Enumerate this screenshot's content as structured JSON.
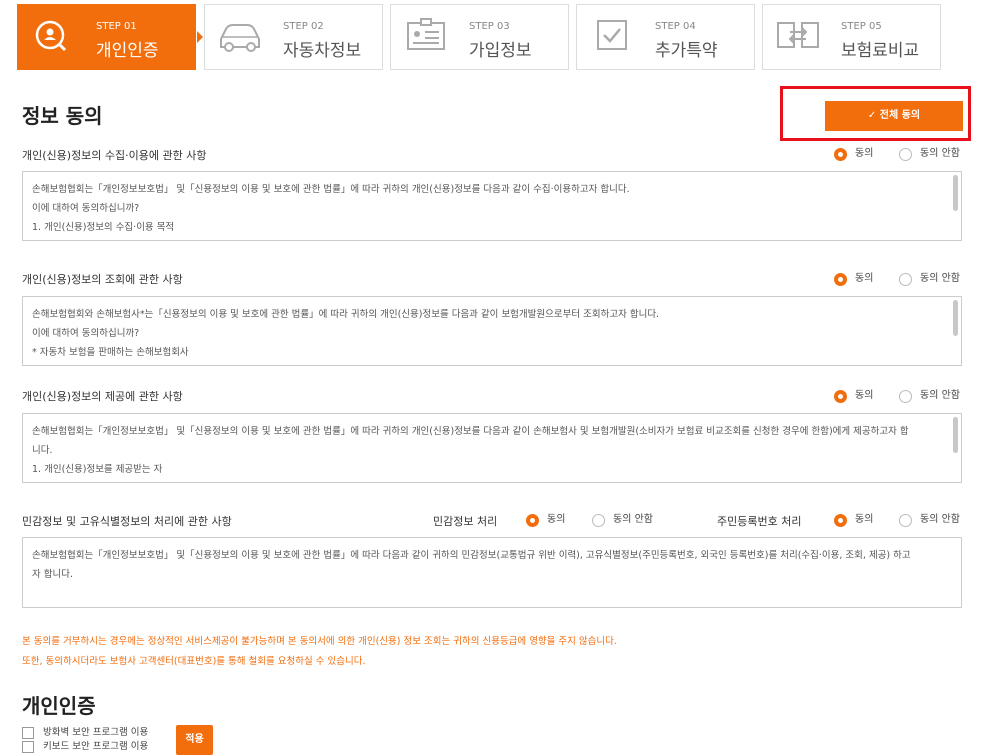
{
  "steps": [
    {
      "num": "STEP 01",
      "label": "개인인증",
      "icon": "search-person-icon"
    },
    {
      "num": "STEP 02",
      "label": "자동차정보",
      "icon": "car-icon"
    },
    {
      "num": "STEP 03",
      "label": "가입정보",
      "icon": "id-card-icon"
    },
    {
      "num": "STEP 04",
      "label": "추가특약",
      "icon": "checkbox-icon"
    },
    {
      "num": "STEP 05",
      "label": "보험료비교",
      "icon": "compare-arrows-icon"
    }
  ],
  "consent": {
    "title": "정보 동의",
    "all_agree_label": "✓ 전체 동의",
    "agree": "동의",
    "disagree": "동의 안함",
    "sections": [
      {
        "title": "개인(신용)정보의 수집·이용에 관한 사항",
        "lines": [
          "손해보험협회는「개인정보보호법」 및「신용정보의 이용 및 보호에 관한 법률」에 따라 귀하의 개인(신용)정보를 다음과 같이 수집·이용하고자 합니다.",
          "이에 대하여 동의하십니까?",
          "1. 개인(신용)정보의 수집·이용 목적"
        ]
      },
      {
        "title": "개인(신용)정보의 조회에 관한 사항",
        "lines": [
          "손해보험협회와 손해보험사*는「신용정보의 이용 및 보호에 관한 법률」에 따라 귀하의 개인(신용)정보를 다음과 같이 보험개발원으로부터 조회하고자 합니다.",
          "이에 대하여 동의하십니까?",
          "* 자동차 보험을 판매하는 손해보험회사"
        ]
      },
      {
        "title": "개인(신용)정보의 제공에 관한 사항",
        "lines": [
          "손해보험협회는「개인정보보호법」 및「신용정보의 이용 및 보호에 관한 법률」에 따라 귀하의 개인(신용)정보를 다음과 같이 손해보험사 및 보험개발원(소비자가 보험료 비교조회를 신청한 경우에 한함)에게 제공하고자 합",
          "니다.",
          "1. 개인(신용)정보를 제공받는 자"
        ]
      },
      {
        "title": "민감정보 및 고유식별정보의 처리에 관한 사항",
        "sub1": "민감정보 처리",
        "sub2": "주민등록번호 처리",
        "lines": [
          "손해보험협회는「개인정보보호법」 및「신용정보의 이용 및 보호에 관한 법률」에 따라 다음과 같이 귀하의 민감정보(교통법규 위반 이력), 고유식별정보(주민등록번호, 외국인 등록번호)를 처리(수집·이용, 조회, 제공) 하고",
          "자 합니다."
        ]
      }
    ],
    "warning": [
      "본 동의를 거부하시는 경우에는 정상적인 서비스제공이 불가능하며 본 동의서에 의한 개인(신용) 정보 조회는 귀하의 신용등급에 영향을 주지 않습니다.",
      "또한, 동의하시더라도 보험사 고객센터(대표번호)를 통해 철회를 요청하실 수 있습니다."
    ]
  },
  "auth": {
    "title": "개인인증",
    "firewall_label": "방화벽 보안 프로그램 이용",
    "keyboard_label": "키보드 보안 프로그램 이용",
    "apply_label": "적용"
  },
  "colors": {
    "accent": "#f26d0c",
    "highlight": "#e8101a"
  }
}
